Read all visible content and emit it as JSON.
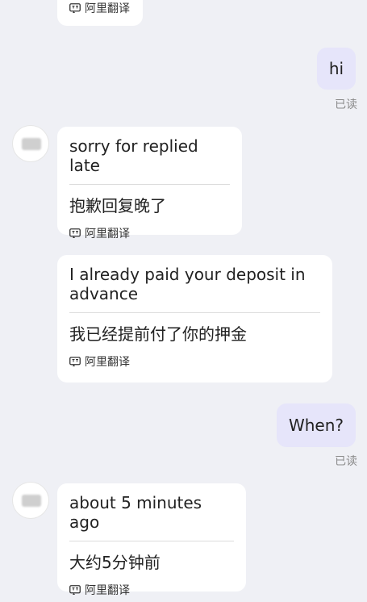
{
  "conversation": {
    "top_partial": {
      "translation_source": "阿里翻译"
    },
    "messages": [
      {
        "direction": "outgoing",
        "text": "hi",
        "status": "已读"
      },
      {
        "direction": "incoming",
        "text": "sorry for replied late",
        "translation": "抱歉回复晚了",
        "translation_source": "阿里翻译"
      },
      {
        "direction": "incoming",
        "text": "I already paid your deposit in advance",
        "translation": "我已经提前付了你的押金",
        "translation_source": "阿里翻译"
      },
      {
        "direction": "outgoing",
        "text": "When?",
        "status": "已读"
      },
      {
        "direction": "incoming",
        "text": "about 5 minutes ago",
        "translation": "大约5分钟前",
        "translation_source": "阿里翻译"
      }
    ]
  }
}
